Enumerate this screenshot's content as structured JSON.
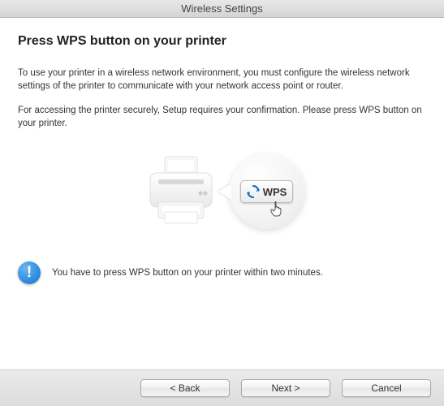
{
  "window": {
    "title": "Wireless Settings"
  },
  "heading": "Press WPS button on your printer",
  "para1": "To use your printer in a wireless network environment, you must configure the wireless network settings of the printer to communicate with your network access point or router.",
  "para2": "For accessing the printer securely, Setup requires your confirmation. Please press WPS button on your printer.",
  "wps_label": "WPS",
  "info_glyph": "!",
  "notice": "You have to press WPS button on your printer within two minutes.",
  "buttons": {
    "back": "< Back",
    "next": "Next >",
    "cancel": "Cancel"
  }
}
